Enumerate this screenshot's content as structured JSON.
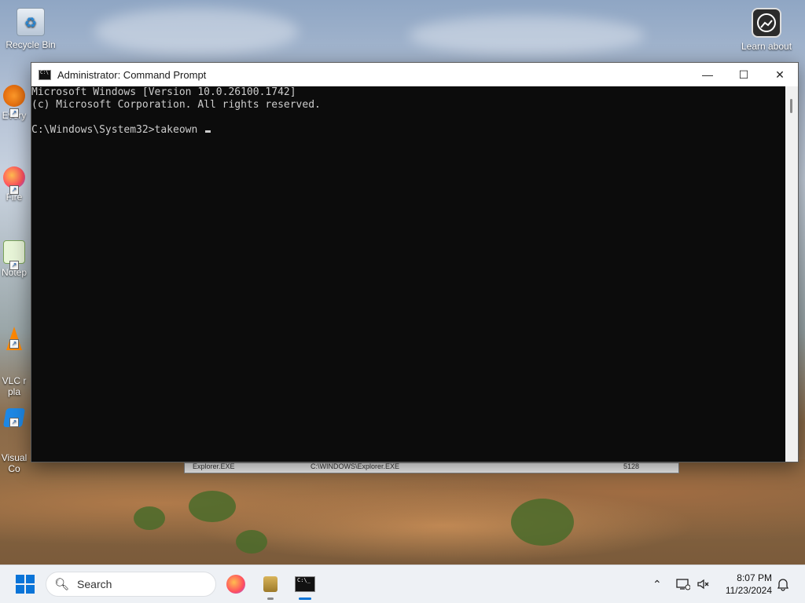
{
  "desktop": {
    "icons": [
      {
        "label": "Recycle Bin"
      },
      {
        "label": "Every"
      },
      {
        "label": "Fire"
      },
      {
        "label": "Notep"
      },
      {
        "label": "VLC r\npla"
      },
      {
        "label": "Visual\nCo"
      }
    ],
    "learn_about": "Learn about"
  },
  "window": {
    "title": "Administrator: Command Prompt",
    "minimize_glyph": "—",
    "maximize_glyph": "☐",
    "close_glyph": "✕",
    "console_lines": [
      "Microsoft Windows [Version 10.0.26100.1742]",
      "(c) Microsoft Corporation. All rights reserved.",
      "",
      "C:\\Windows\\System32>takeown "
    ]
  },
  "background_window": {
    "name": "Explorer.EXE",
    "path": "C:\\WINDOWS\\Explorer.EXE",
    "pid": "5128"
  },
  "taskbar": {
    "search_placeholder": "Search",
    "time": "8:07 PM",
    "date": "11/23/2024"
  },
  "colors": {
    "console_bg": "#0c0c0c",
    "console_fg": "#cccccc",
    "start_blue": "#0a74d8"
  }
}
